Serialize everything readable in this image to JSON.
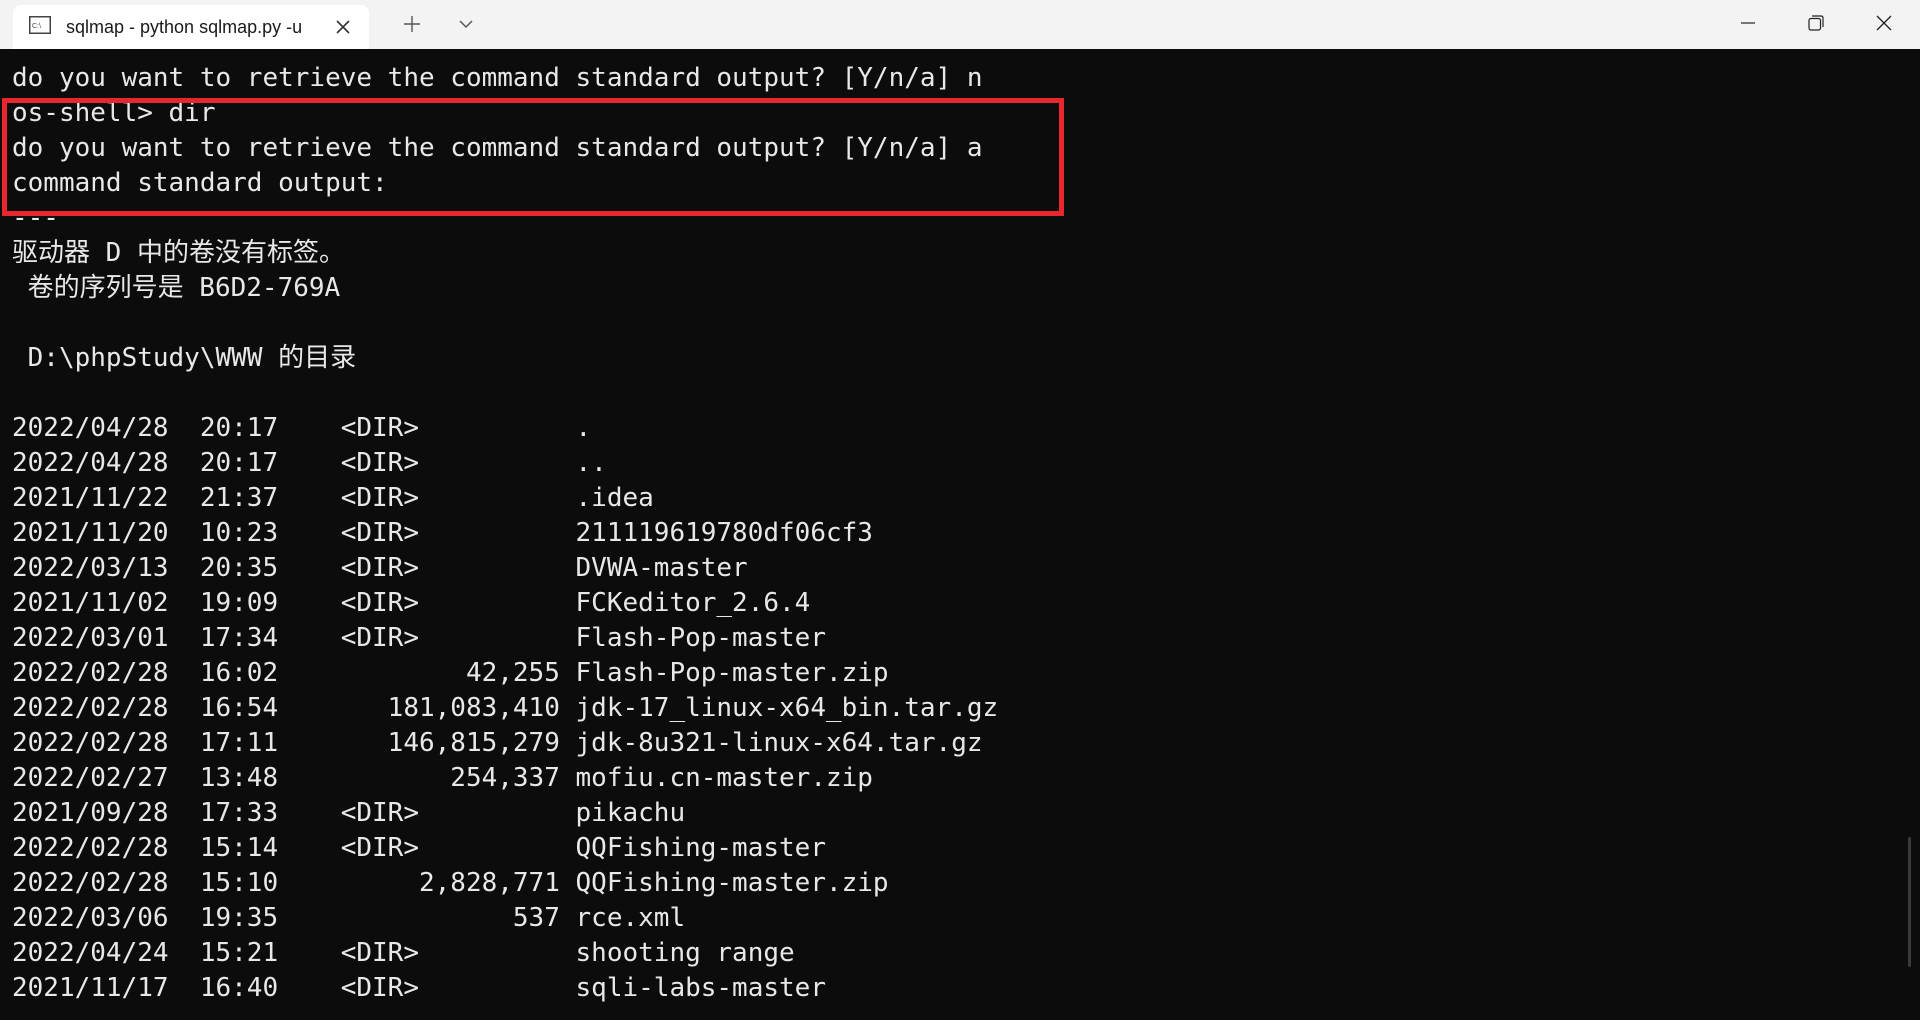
{
  "tab": {
    "icon": "terminal-icon",
    "title": "sqlmap - python  sqlmap.py -u"
  },
  "window_controls": [
    "minimize-icon",
    "maximize-icon",
    "close-icon"
  ],
  "colors": {
    "terminal_bg": "#0c0c0c",
    "terminal_text": "#e8e8e8",
    "titlebar_bg": "#f3f3f3",
    "highlight": "#e8262d"
  },
  "terminal": {
    "lines": [
      "do you want to retrieve the command standard output? [Y/n/a] n",
      "os-shell> dir",
      "do you want to retrieve the command standard output? [Y/n/a] a",
      "command standard output:",
      "---",
      "驱动器 D 中的卷没有标签。",
      " 卷的序列号是 B6D2-769A",
      "",
      " D:\\phpStudy\\WWW 的目录",
      "",
      "2022/04/28  20:17    <DIR>          .",
      "2022/04/28  20:17    <DIR>          ..",
      "2021/11/22  21:37    <DIR>          .idea",
      "2021/11/20  10:23    <DIR>          211119619780df06cf3",
      "2022/03/13  20:35    <DIR>          DVWA-master",
      "2021/11/02  19:09    <DIR>          FCKeditor_2.6.4",
      "2022/03/01  17:34    <DIR>          Flash-Pop-master",
      "2022/02/28  16:02            42,255 Flash-Pop-master.zip",
      "2022/02/28  16:54       181,083,410 jdk-17_linux-x64_bin.tar.gz",
      "2022/02/28  17:11       146,815,279 jdk-8u321-linux-x64.tar.gz",
      "2022/02/27  13:48           254,337 mofiu.cn-master.zip",
      "2021/09/28  17:33    <DIR>          pikachu",
      "2022/02/28  15:14    <DIR>          QQFishing-master",
      "2022/02/28  15:10         2,828,771 QQFishing-master.zip",
      "2022/03/06  19:35               537 rce.xml",
      "2022/04/24  15:21    <DIR>          shooting range",
      "2021/11/17  16:40    <DIR>          sqli-labs-master"
    ]
  }
}
